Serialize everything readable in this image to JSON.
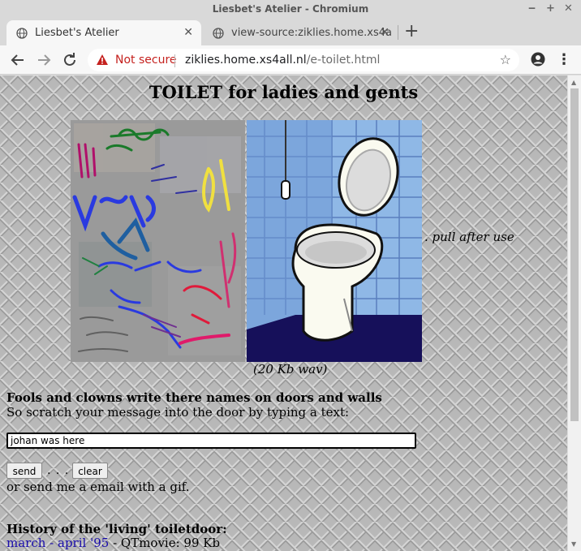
{
  "window": {
    "title": "Liesbet's Atelier - Chromium",
    "controls": [
      "‒",
      "+",
      "✕"
    ]
  },
  "tabs": [
    {
      "label": "Liesbet's Atelier",
      "close": "✕"
    },
    {
      "label": "view-source:ziklies.home.xs4a",
      "close": "✕"
    }
  ],
  "new_tab": "+",
  "toolbar": {
    "back_icon": "arrow-left-icon",
    "forward_icon": "arrow-right-icon",
    "reload_icon": "reload-icon",
    "security_label": "Not secure",
    "url_domain": "ziklies.home.xs4all.nl",
    "url_path": "/e-toilet.html",
    "star": "☆",
    "menu": "⋮"
  },
  "page": {
    "title": "TOILET for ladies and gents",
    "pull_caption": ". pull after use",
    "wav_caption": "(20 Kb wav)",
    "fools_heading": "Fools and clowns write there names on doors and walls",
    "scratch_text": "So scratch your message into the door by typing a text:",
    "message_value": "johan was here",
    "send_label": "send",
    "dots": ". . . .",
    "clear_label": "clear",
    "or_send_text": "or send me a email with a gif.",
    "history_heading": "History of the 'living' toiletdoor:",
    "history_link": "march - april '95",
    "history_suffix": " - QTmovie: 99 Kb"
  },
  "colors": {
    "security_red": "#c5221f",
    "link_blue": "#1a0dab",
    "wall_tile": "#8fb8e6",
    "floor": "#16105a"
  }
}
